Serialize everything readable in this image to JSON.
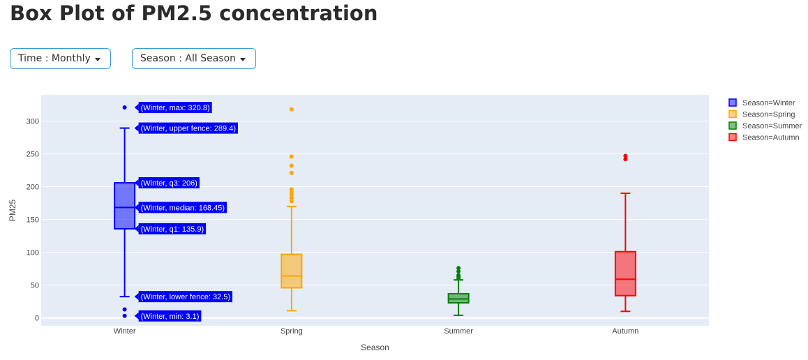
{
  "page": {
    "title": "Box Plot of PM2.5 concentration",
    "dropdowns": [
      {
        "label": "Time : Monthly"
      },
      {
        "label": "Season : All Season"
      }
    ]
  },
  "chart_data": {
    "type": "box",
    "xlabel": "Season",
    "ylabel": "PM25",
    "ylim": [
      -12,
      340
    ],
    "yticks": [
      0,
      50,
      100,
      150,
      200,
      250,
      300
    ],
    "grid": true,
    "legend_position": "right",
    "series": [
      {
        "name": "Season=Winter",
        "category": "Winter",
        "color": "#0000ff",
        "min": 32.5,
        "q1": 135.9,
        "median": 168.45,
        "q3": 206,
        "max": 289.4,
        "outliers": [
          320.8,
          13,
          3.1
        ]
      },
      {
        "name": "Season=Spring",
        "category": "Spring",
        "color": "#ffa500",
        "min": 11,
        "q1": 46,
        "median": 64,
        "q3": 97,
        "max": 170,
        "outliers": [
          318,
          246,
          232,
          221,
          196,
          192,
          188,
          183,
          178
        ]
      },
      {
        "name": "Season=Summer",
        "category": "Summer",
        "color": "#008000",
        "min": 4,
        "q1": 23,
        "median": 29,
        "q3": 37,
        "max": 58,
        "outliers": [
          60,
          63,
          65,
          71,
          76
        ]
      },
      {
        "name": "Season=Autumn",
        "category": "Autumn",
        "color": "#ff0000",
        "min": 10,
        "q1": 34,
        "median": 59,
        "q3": 101,
        "max": 190,
        "outliers": [
          247,
          242
        ]
      }
    ],
    "hover_labels": [
      {
        "text": "(Winter, max: 320.8)",
        "value": 320.8
      },
      {
        "text": "(Winter, upper fence: 289.4)",
        "value": 289.4
      },
      {
        "text": "(Winter, q3: 206)",
        "value": 206
      },
      {
        "text": "(Winter, median: 168.45)",
        "value": 168.45
      },
      {
        "text": "(Winter, q1: 135.9)",
        "value": 135.9
      },
      {
        "text": "(Winter, lower fence: 32.5)",
        "value": 32.5
      },
      {
        "text": "(Winter, min: 3.1)",
        "value": 3.1
      }
    ]
  }
}
